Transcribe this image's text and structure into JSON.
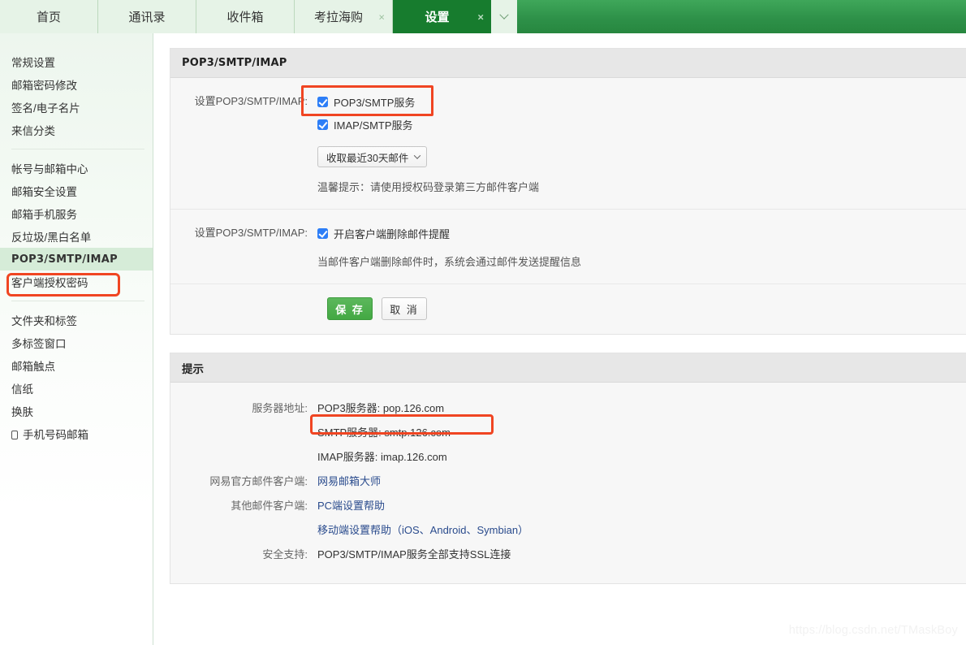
{
  "tabs": [
    {
      "label": "首页",
      "closable": false,
      "active": false,
      "name": "tab-home"
    },
    {
      "label": "通讯录",
      "closable": false,
      "active": false,
      "name": "tab-contacts"
    },
    {
      "label": "收件箱",
      "closable": false,
      "active": false,
      "name": "tab-inbox"
    },
    {
      "label": "考拉海购",
      "closable": true,
      "active": false,
      "name": "tab-kaola"
    },
    {
      "label": "设置",
      "closable": true,
      "active": true,
      "name": "tab-settings"
    }
  ],
  "tabbar": {
    "close_glyph": "×",
    "more_name": "tab-overflow-button"
  },
  "sidebar": {
    "group1": [
      {
        "label": "常规设置"
      },
      {
        "label": "邮箱密码修改"
      },
      {
        "label": "签名/电子名片"
      },
      {
        "label": "来信分类"
      }
    ],
    "group2": [
      {
        "label": "帐号与邮箱中心",
        "active": false
      },
      {
        "label": "邮箱安全设置",
        "active": false
      },
      {
        "label": "邮箱手机服务",
        "active": false
      },
      {
        "label": "反垃圾/黑白名单",
        "active": false
      },
      {
        "label": "POP3/SMTP/IMAP",
        "active": true
      },
      {
        "label": "客户端授权密码",
        "active": false
      }
    ],
    "group3": [
      {
        "label": "文件夹和标签",
        "icon": null
      },
      {
        "label": "多标签窗口",
        "icon": null
      },
      {
        "label": "邮箱触点",
        "icon": null
      },
      {
        "label": "信纸",
        "icon": null
      },
      {
        "label": "换肤",
        "icon": null
      },
      {
        "label": "手机号码邮箱",
        "icon": "phone-icon"
      }
    ]
  },
  "settings_panel": {
    "title": "POP3/SMTP/IMAP",
    "row1": {
      "label": "设置POP3/SMTP/IMAP:",
      "checkbox1": {
        "label": "POP3/SMTP服务",
        "checked": true
      },
      "checkbox2": {
        "label": "IMAP/SMTP服务",
        "checked": true
      },
      "select_value": "收取最近30天邮件",
      "hint": "温馨提示：请使用授权码登录第三方邮件客户端"
    },
    "row2": {
      "label": "设置POP3/SMTP/IMAP:",
      "checkbox1": {
        "label": "开启客户端删除邮件提醒",
        "checked": true
      },
      "note": "当邮件客户端删除邮件时，系统会通过邮件发送提醒信息"
    },
    "buttons": {
      "save": "保 存",
      "cancel": "取 消"
    }
  },
  "tips_panel": {
    "title": "提示",
    "rows": [
      {
        "label": "服务器地址:",
        "value": "POP3服务器: pop.126.com",
        "link": false
      },
      {
        "label": "",
        "value": "SMTP服务器: smtp.126.com",
        "link": false
      },
      {
        "label": "",
        "value": "IMAP服务器: imap.126.com",
        "link": false
      },
      {
        "label": "网易官方邮件客户端:",
        "value": "网易邮箱大师",
        "link": true
      },
      {
        "label": "其他邮件客户端:",
        "value": "PC端设置帮助",
        "link": true
      },
      {
        "label": "",
        "value": "移动端设置帮助（iOS、Android、Symbian）",
        "link": false
      },
      {
        "label": "安全支持:",
        "value": "POP3/SMTP/IMAP服务全部支持SSL连接",
        "link": false
      }
    ]
  },
  "annotations": {
    "color": "#f04522",
    "targets": [
      "POP3/SMTP服务",
      "客户端授权密码",
      "SMTP服务器: smtp.126.com"
    ]
  },
  "watermark": "https://blog.csdn.net/TMaskBoy"
}
